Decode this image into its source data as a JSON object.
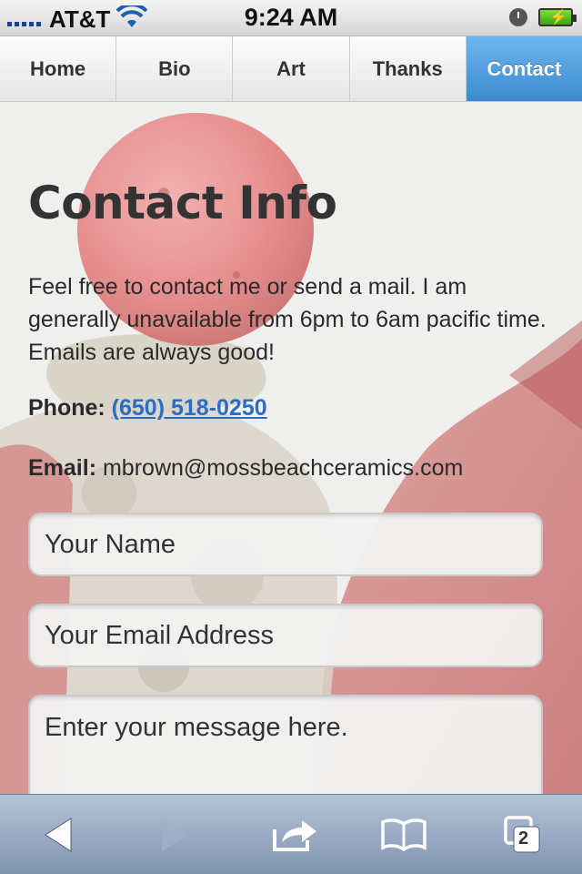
{
  "status_bar": {
    "carrier": "AT&T",
    "time": "9:24 AM",
    "battery_glyph": "⚡"
  },
  "nav": {
    "tabs": [
      {
        "label": "Home"
      },
      {
        "label": "Bio"
      },
      {
        "label": "Art"
      },
      {
        "label": "Thanks"
      },
      {
        "label": "Contact",
        "active": true
      }
    ]
  },
  "main": {
    "title": "Contact Info",
    "intro": "Feel free to contact me or send a mail. I am generally unavailable from 6pm to 6am pacific time. Emails are always good!",
    "phone_label": "Phone:",
    "phone_value": "(650) 518-0250",
    "email_label": "Email:",
    "email_value": "mbrown@mossbeachceramics.com"
  },
  "form": {
    "name_placeholder": "Your Name",
    "email_placeholder": "Your Email Address",
    "message_placeholder": "Enter your message here."
  },
  "toolbar": {
    "tabs_count": "2"
  },
  "colors": {
    "accent": "#3a8bd0",
    "link": "#2a6cc6",
    "toolbar": "#8193b0"
  }
}
